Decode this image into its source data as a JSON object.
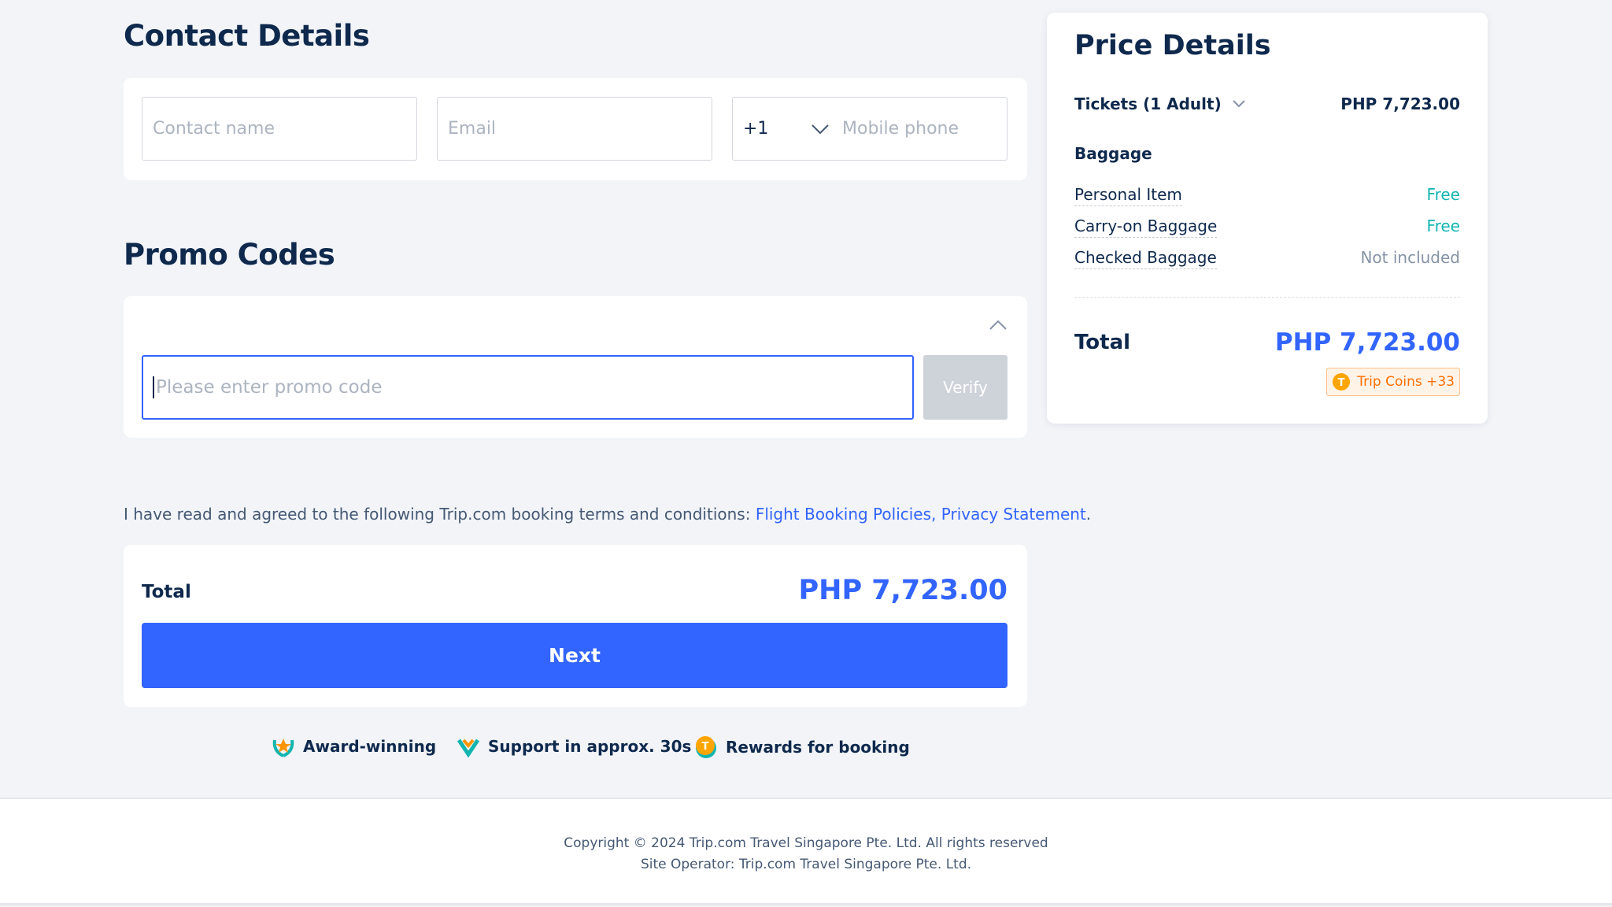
{
  "contact": {
    "title": "Contact Details",
    "name_placeholder": "Contact name",
    "email_placeholder": "Email",
    "country_code": "+1",
    "phone_placeholder": "Mobile phone"
  },
  "promo": {
    "title": "Promo Codes",
    "placeholder": "Please enter promo code",
    "verify_label": "Verify"
  },
  "terms": {
    "text": "I have read and agreed to the following Trip.com booking terms and conditions: ",
    "link1": "Flight Booking Policies,",
    "link2": "Privacy Statement",
    "end": "."
  },
  "total_card": {
    "label": "Total",
    "amount": "PHP 7,723.00",
    "next_label": "Next"
  },
  "features": [
    {
      "icon": "laurel-star-icon",
      "label": "Award-winning"
    },
    {
      "icon": "heart-check-icon",
      "label": "Support in approx. 30s"
    },
    {
      "icon": "coin-icon",
      "label": "Rewards for booking"
    }
  ],
  "footer": {
    "copyright": "Copyright © 2024 Trip.com Travel Singapore Pte. Ltd. All rights reserved",
    "operator": "Site Operator: Trip.com Travel Singapore Pte. Ltd."
  },
  "price": {
    "title": "Price Details",
    "tickets_label": "Tickets (1 Adult)",
    "tickets_amount": "PHP 7,723.00",
    "baggage_title": "Baggage",
    "baggage": [
      {
        "label": "Personal Item",
        "value": "Free"
      },
      {
        "label": "Carry-on Baggage",
        "value": "Free"
      },
      {
        "label": "Checked Baggage",
        "value": "Not included"
      }
    ],
    "total_label": "Total",
    "total_amount": "PHP 7,723.00",
    "coins": "Trip Coins +33"
  },
  "colors": {
    "accent": "#3264ff",
    "free": "#13b5b1",
    "coins": "#ff6f00"
  }
}
